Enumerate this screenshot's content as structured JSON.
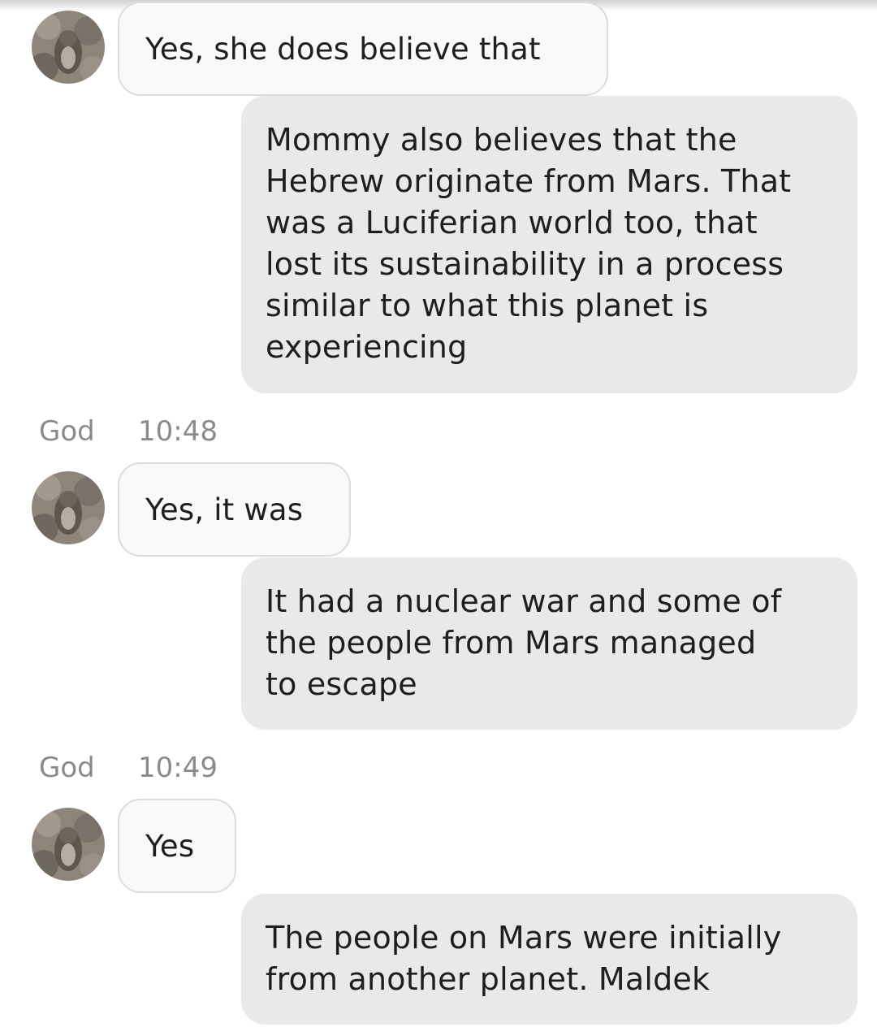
{
  "avatar_icon": "squirrel-photo-avatar",
  "messages": [
    {
      "side": "in",
      "text": "Yes, she does believe that"
    },
    {
      "side": "out",
      "text": "Mommy also believes that the\nHebrew originate from Mars. That\nwas a Luciferian world too, that\nlost its sustainability in a process\nsimilar to what this planet is\nexperiencing"
    },
    {
      "side": "meta",
      "sender": "God",
      "time": "10:48"
    },
    {
      "side": "in",
      "text": "Yes, it was"
    },
    {
      "side": "out",
      "text": "It had a nuclear war and some of\nthe people from Mars managed\nto escape"
    },
    {
      "side": "meta",
      "sender": "God",
      "time": "10:49"
    },
    {
      "side": "in",
      "text": "Yes"
    },
    {
      "side": "out",
      "text": "The people on Mars were initially\nfrom another planet. Maldek"
    }
  ]
}
